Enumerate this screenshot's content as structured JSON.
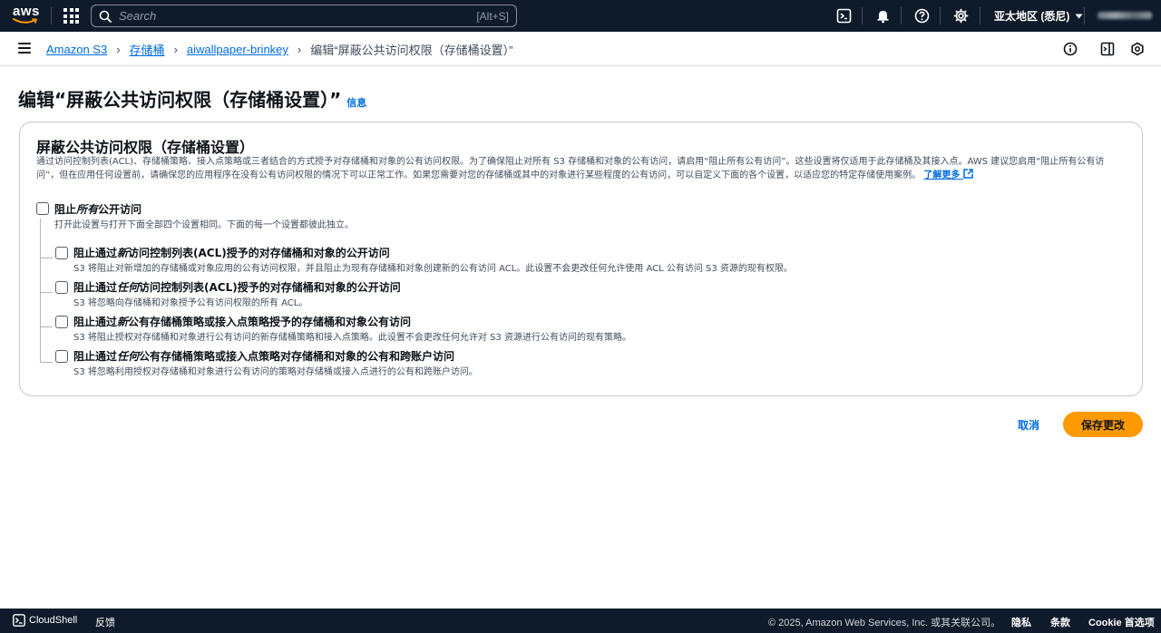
{
  "topnav": {
    "logo_text": "aws",
    "search_placeholder": "Search",
    "search_shortcut": "[Alt+S]",
    "region_label": "亚太地区 (悉尼)"
  },
  "breadcrumb": {
    "items": [
      "Amazon S3",
      "存储桶",
      "aiwallpaper-brinkey"
    ],
    "current": "编辑“屏蔽公共访问权限（存储桶设置）”"
  },
  "page": {
    "title": "编辑“屏蔽公共访问权限（存储桶设置）”",
    "info_link": "信息"
  },
  "panel": {
    "heading": "屏蔽公共访问权限（存储桶设置）",
    "description": "通过访问控制列表(ACL)、存储桶策略、接入点策略或三者结合的方式授予对存储桶和对象的公有访问权限。为了确保阻止对所有 S3 存储桶和对象的公有访问，请启用“阻止所有公有访问”。这些设置将仅适用于此存储桶及其接入点。AWS 建议您启用“阻止所有公有访问”，但在应用任何设置前，请确保您的应用程序在没有公有访问权限的情况下可以正常工作。如果您需要对您的存储桶或其中的对象进行某些程度的公有访问，可以自定义下面的各个设置，以适应您的特定存储使用案例。",
    "learn_more": "了解更多",
    "block_all": {
      "label_pre": "阻止",
      "label_em": "所有",
      "label_post": "公开访问",
      "desc": "打开此设置与打开下面全部四个设置相同。下面的每一个设置都彼此独立。",
      "checked": false
    },
    "options": [
      {
        "label_pre": "阻止通过",
        "label_em": "新",
        "label_post": "访问控制列表(ACL)授予的对存储桶和对象的公开访问",
        "desc": "S3 将阻止对新增加的存储桶或对象应用的公有访问权限，并且阻止为现有存储桶和对象创建新的公有访问 ACL。此设置不会更改任何允许使用 ACL 公有访问 S3 资源的现有权限。",
        "checked": false
      },
      {
        "label_pre": "阻止通过",
        "label_em": "任何",
        "label_post": "访问控制列表(ACL)授予的对存储桶和对象的公开访问",
        "desc": "S3 将忽略向存储桶和对象授予公有访问权限的所有 ACL。",
        "checked": false
      },
      {
        "label_pre": "阻止通过",
        "label_em": "新",
        "label_post": "公有存储桶策略或接入点策略授予的存储桶和对象公有访问",
        "desc": "S3 将阻止授权对存储桶和对象进行公有访问的新存储桶策略和接入点策略。此设置不会更改任何允许对 S3 资源进行公有访问的现有策略。",
        "checked": false
      },
      {
        "label_pre": "阻止通过",
        "label_em": "任何",
        "label_post": "公有存储桶策略或接入点策略对存储桶和对象的公有和跨账户访问",
        "desc": "S3 将忽略利用授权对存储桶和对象进行公有访问的策略对存储桶或接入点进行的公有和跨账户访问。",
        "checked": false
      }
    ]
  },
  "actions": {
    "cancel": "取消",
    "save": "保存更改"
  },
  "footer": {
    "cloudshell": "CloudShell",
    "feedback": "反馈",
    "copyright": "© 2025, Amazon Web Services, Inc. 或其关联公司。",
    "privacy": "隐私",
    "terms": "条款",
    "cookie": "Cookie 首选项"
  },
  "colors": {
    "nav_bg": "#0f1b2a",
    "link": "#006ce0",
    "primary_button": "#ff9900"
  }
}
